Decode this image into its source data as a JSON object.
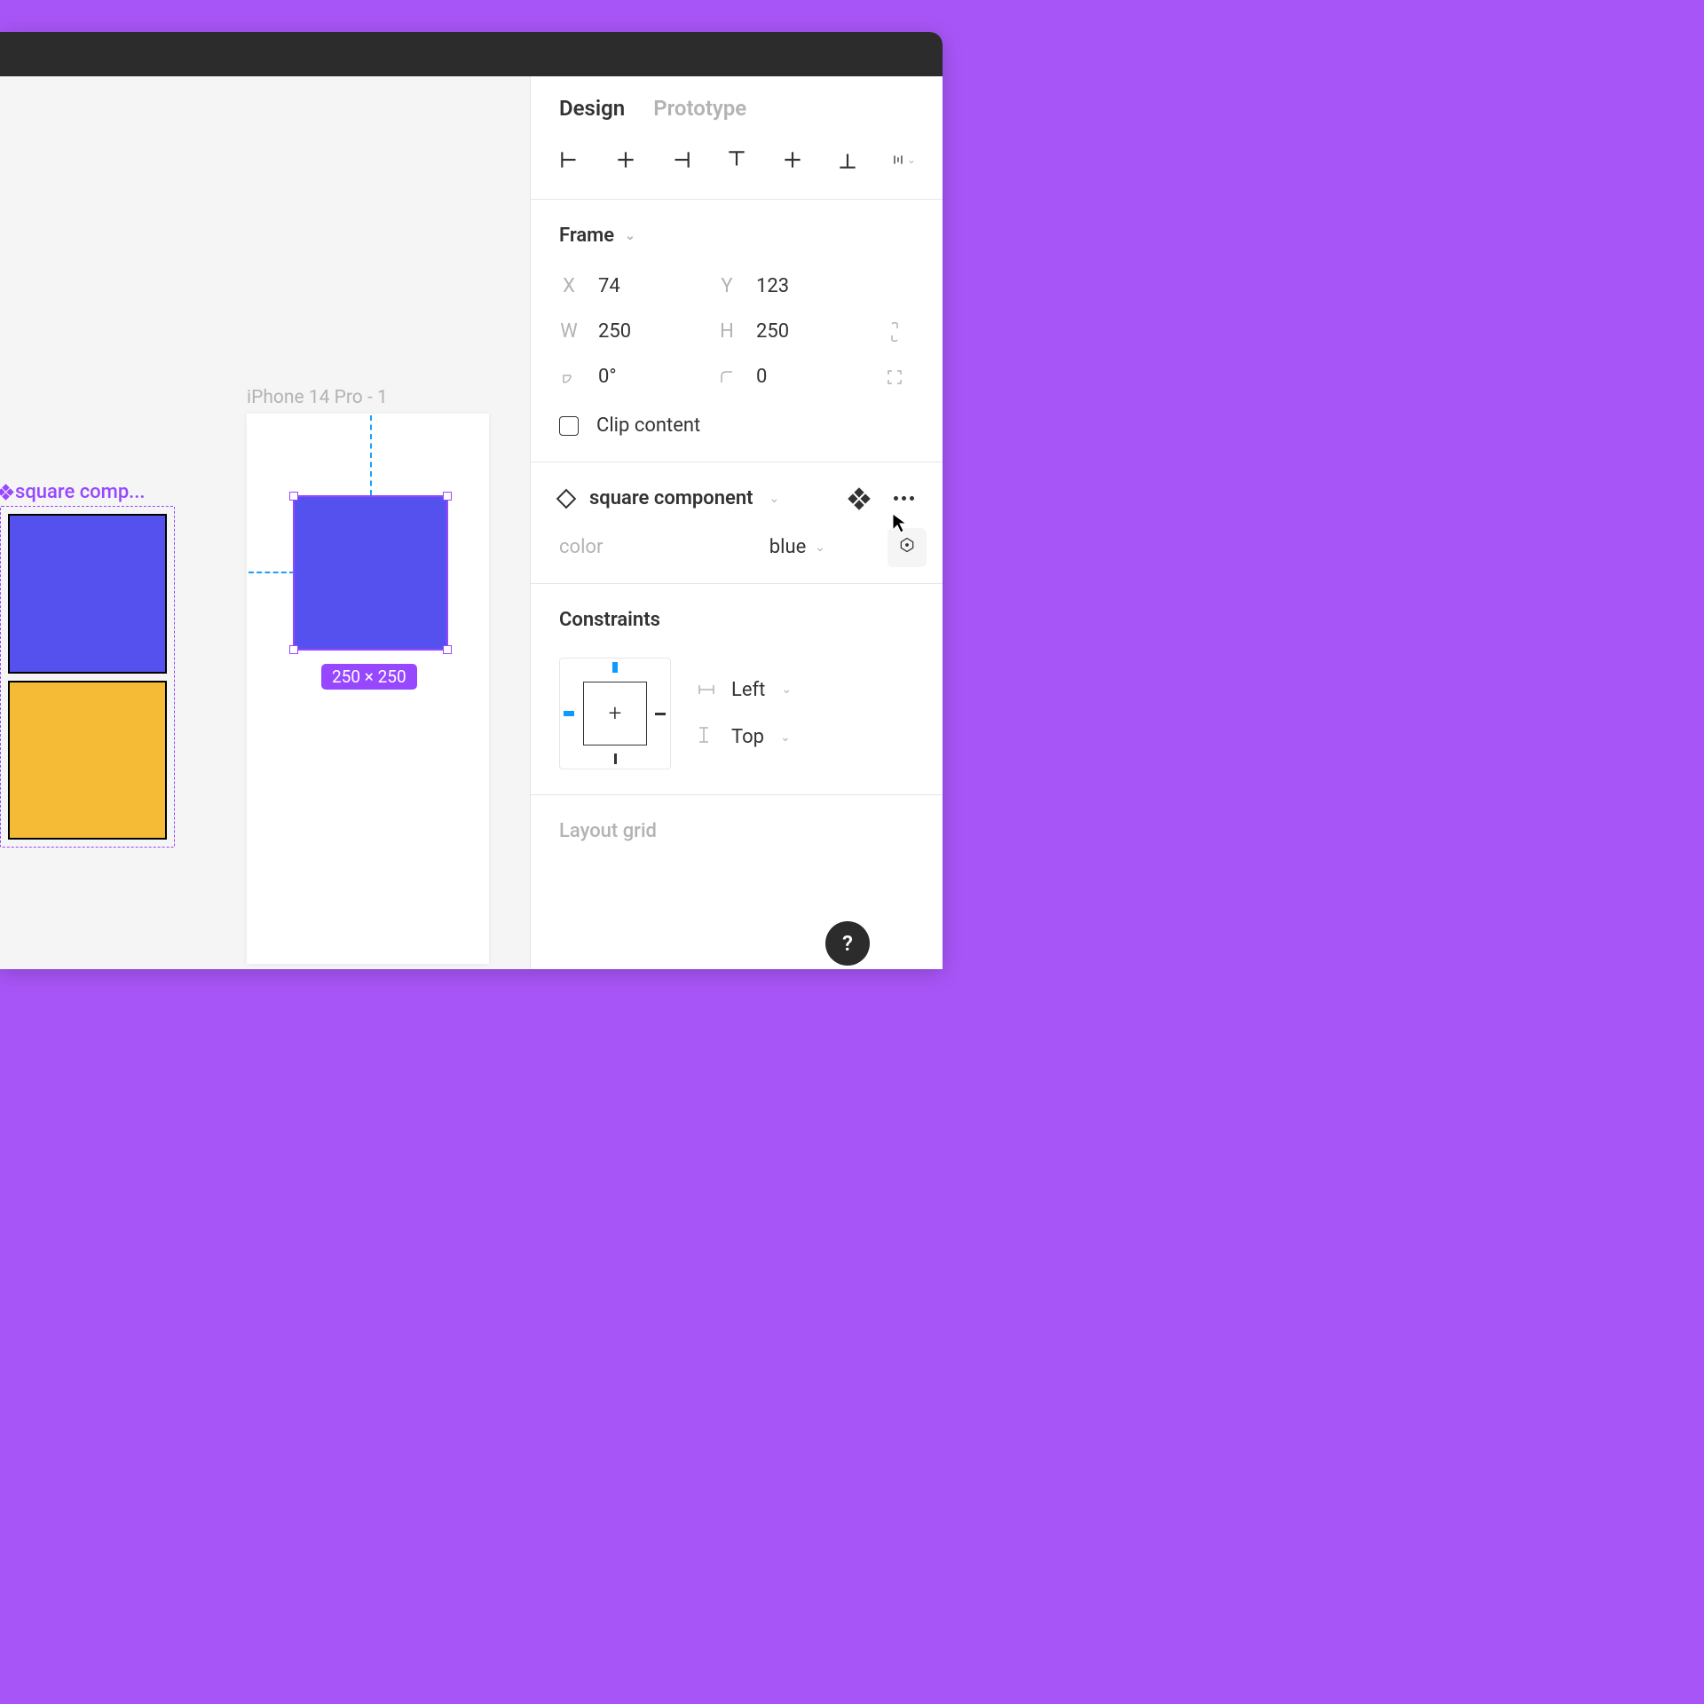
{
  "canvas": {
    "frame_label": "iPhone 14 Pro - 1",
    "component_label": "square comp...",
    "size_badge": "250 × 250"
  },
  "panel": {
    "tabs": {
      "design": "Design",
      "prototype": "Prototype"
    },
    "frame": {
      "title": "Frame",
      "x_label": "X",
      "x_value": "74",
      "y_label": "Y",
      "y_value": "123",
      "w_label": "W",
      "w_value": "250",
      "h_label": "H",
      "h_value": "250",
      "rot_value": "0°",
      "radius_value": "0",
      "clip_label": "Clip content"
    },
    "component": {
      "name": "square component",
      "prop_label": "color",
      "prop_value": "blue"
    },
    "constraints": {
      "title": "Constraints",
      "h_value": "Left",
      "v_value": "Top"
    },
    "layout_grid": {
      "title": "Layout grid"
    },
    "help": "?"
  },
  "colors": {
    "purple_bg": "#a855f7",
    "component_purple": "#9747ff",
    "swatch_blue": "#5551ef",
    "swatch_gold": "#f5ba36",
    "guide_blue": "#18a0fb"
  }
}
